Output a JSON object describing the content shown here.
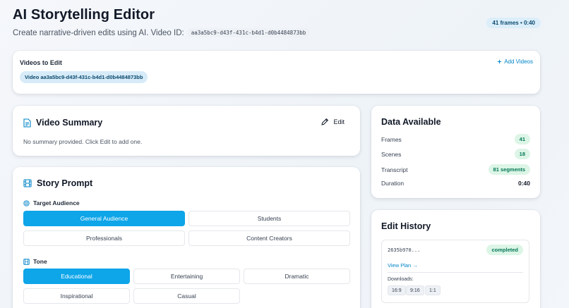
{
  "header": {
    "title": "AI Storytelling Editor",
    "subtitle": "Create narrative-driven edits using AI. Video ID:",
    "video_id": "aa3a5bc9-d43f-431c-b4d1-d0b4484873bb",
    "frames_badge": "41 frames • 0:40"
  },
  "videos": {
    "label": "Videos to Edit",
    "add_label": "Add Videos",
    "chip": "Video aa3a5bc9-d43f-431c-b4d1-d0b4484873bb"
  },
  "summary": {
    "title": "Video Summary",
    "edit_label": "Edit",
    "text": "No summary provided. Click Edit to add one."
  },
  "story": {
    "title": "Story Prompt",
    "audience_label": "Target Audience",
    "audience_options": [
      "General Audience",
      "Students",
      "Professionals",
      "Content Creators"
    ],
    "audience_selected": "General Audience",
    "tone_label": "Tone",
    "tone_options": [
      "Educational",
      "Entertaining",
      "Dramatic",
      "Inspirational",
      "Casual"
    ],
    "tone_selected": "Educational"
  },
  "data_available": {
    "title": "Data Available",
    "rows": [
      {
        "label": "Frames",
        "value": "41"
      },
      {
        "label": "Scenes",
        "value": "18"
      },
      {
        "label": "Transcript",
        "value": "81 segments"
      },
      {
        "label": "Duration",
        "value": "0:40"
      }
    ]
  },
  "history": {
    "title": "Edit History",
    "hash": "2635b970...",
    "status": "completed",
    "view_plan": "View Plan →",
    "downloads_label": "Downloads:",
    "ratios": [
      "16:9",
      "9:16",
      "1:1"
    ]
  },
  "colors": {
    "accent": "#0ea5e9",
    "link": "#0284c7",
    "success_bg": "#dcf5e6",
    "success_text": "#047857"
  }
}
